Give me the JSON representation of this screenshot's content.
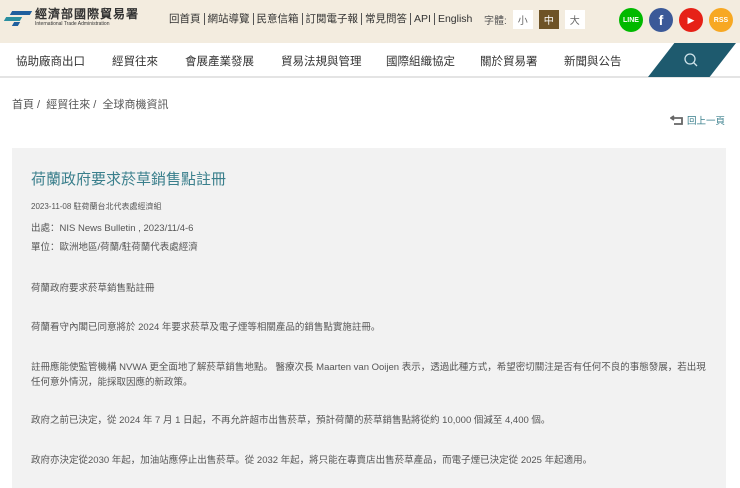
{
  "header": {
    "logo_cn": "經濟部國際貿易署",
    "logo_en": "International Trade Administration",
    "links": [
      "回首頁",
      "網站導覽",
      "民意信箱",
      "訂閱電子報",
      "常見問答",
      "API",
      "English"
    ],
    "font_label": "字體:",
    "font_sizes": [
      "小",
      "中",
      "大"
    ],
    "font_active": "中",
    "social": [
      {
        "name": "line",
        "label": "LINE",
        "color": "#00b900"
      },
      {
        "name": "facebook",
        "label": "f",
        "color": "#3b5998"
      },
      {
        "name": "youtube",
        "label": "▶",
        "color": "#e62117"
      },
      {
        "name": "rss",
        "label": "RSS",
        "color": "#f7a823"
      }
    ]
  },
  "nav": [
    "協助廠商出口",
    "經貿往來",
    "會展產業發展",
    "貿易法規與管理",
    "國際組織協定",
    "關於貿易署",
    "新聞與公告"
  ],
  "breadcrumb": [
    "首頁 /",
    "經貿往來 /",
    "全球商機資訊"
  ],
  "back_label": "回上一頁",
  "article": {
    "title": "荷蘭政府要求菸草銷售點註冊",
    "meta": "2023-11-08 駐荷蘭台北代表處經濟組",
    "source": "出處：NIS News Bulletin , 2023/11/4-6",
    "unit": "單位：歐洲地區/荷蘭/駐荷蘭代表處經濟",
    "paragraphs": [
      "荷蘭政府要求菸草銷售點註冊",
      "荷蘭看守內閣已同意將於 2024 年要求菸草及電子煙等相關產品的銷售點實施註冊。",
      "註冊應能使監管機構 NVWA 更全面地了解菸草銷售地點。 醫療次長 Maarten van Ooijen 表示，透過此種方式，希望密切關注是否有任何不良的事態發展，若出現任何意外情況，能採取因應的新政策。",
      "政府之前已決定，從 2024 年 7 月 1 日起，不再允許超市出售菸草，預計荷蘭的菸草銷售點將從約 10,000 個減至 4,400 個。",
      "政府亦決定從2030 年起，加油站應停止出售菸草。從 2032 年起，將只能在專賣店出售菸草產品，而電子煙已決定從 2025 年起適用。"
    ]
  }
}
